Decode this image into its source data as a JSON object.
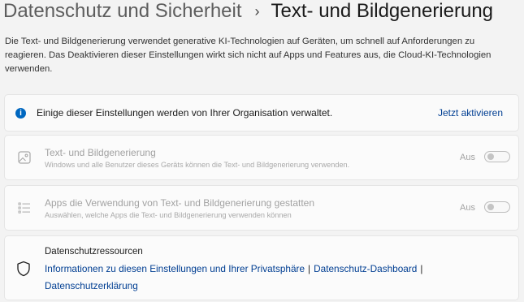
{
  "breadcrumb": {
    "parent": "Datenschutz und Sicherheit",
    "separator": "›",
    "current": "Text- und Bildgenerierung"
  },
  "description": "Die Text- und Bildgenerierung verwendet generative KI-Technologien auf Geräten, um schnell auf Anforderungen zu reagieren. Das Deaktivieren dieser Einstellungen wirkt sich nicht auf Apps und Features aus, die Cloud-KI-Technologien verwenden.",
  "info_banner": {
    "icon": "info-icon",
    "text": "Einige dieser Einstellungen werden von Ihrer Organisation verwaltet.",
    "link": "Jetzt aktivieren",
    "accent": "#0067c0"
  },
  "settings": [
    {
      "icon": "image-icon",
      "title": "Text- und Bildgenerierung",
      "subtitle": "Windows und alle Benutzer dieses Geräts können die Text- und Bildgenerierung verwenden.",
      "toggle_label": "Aus",
      "toggle_on": false,
      "disabled": true
    },
    {
      "icon": "app-list-icon",
      "title": "Apps die Verwendung von Text- und Bildgenerierung gestatten",
      "subtitle": "Auswählen, welche Apps die Text- und Bildgenerierung verwenden können",
      "toggle_label": "Aus",
      "toggle_on": false,
      "disabled": true
    }
  ],
  "resources": {
    "icon": "shield-icon",
    "title": "Datenschutzressourcen",
    "links": [
      "Informationen zu diesen Einstellungen und Ihrer Privatsphäre",
      "Datenschutz-Dashboard",
      "Datenschutzerklärung"
    ],
    "separator": "|"
  }
}
